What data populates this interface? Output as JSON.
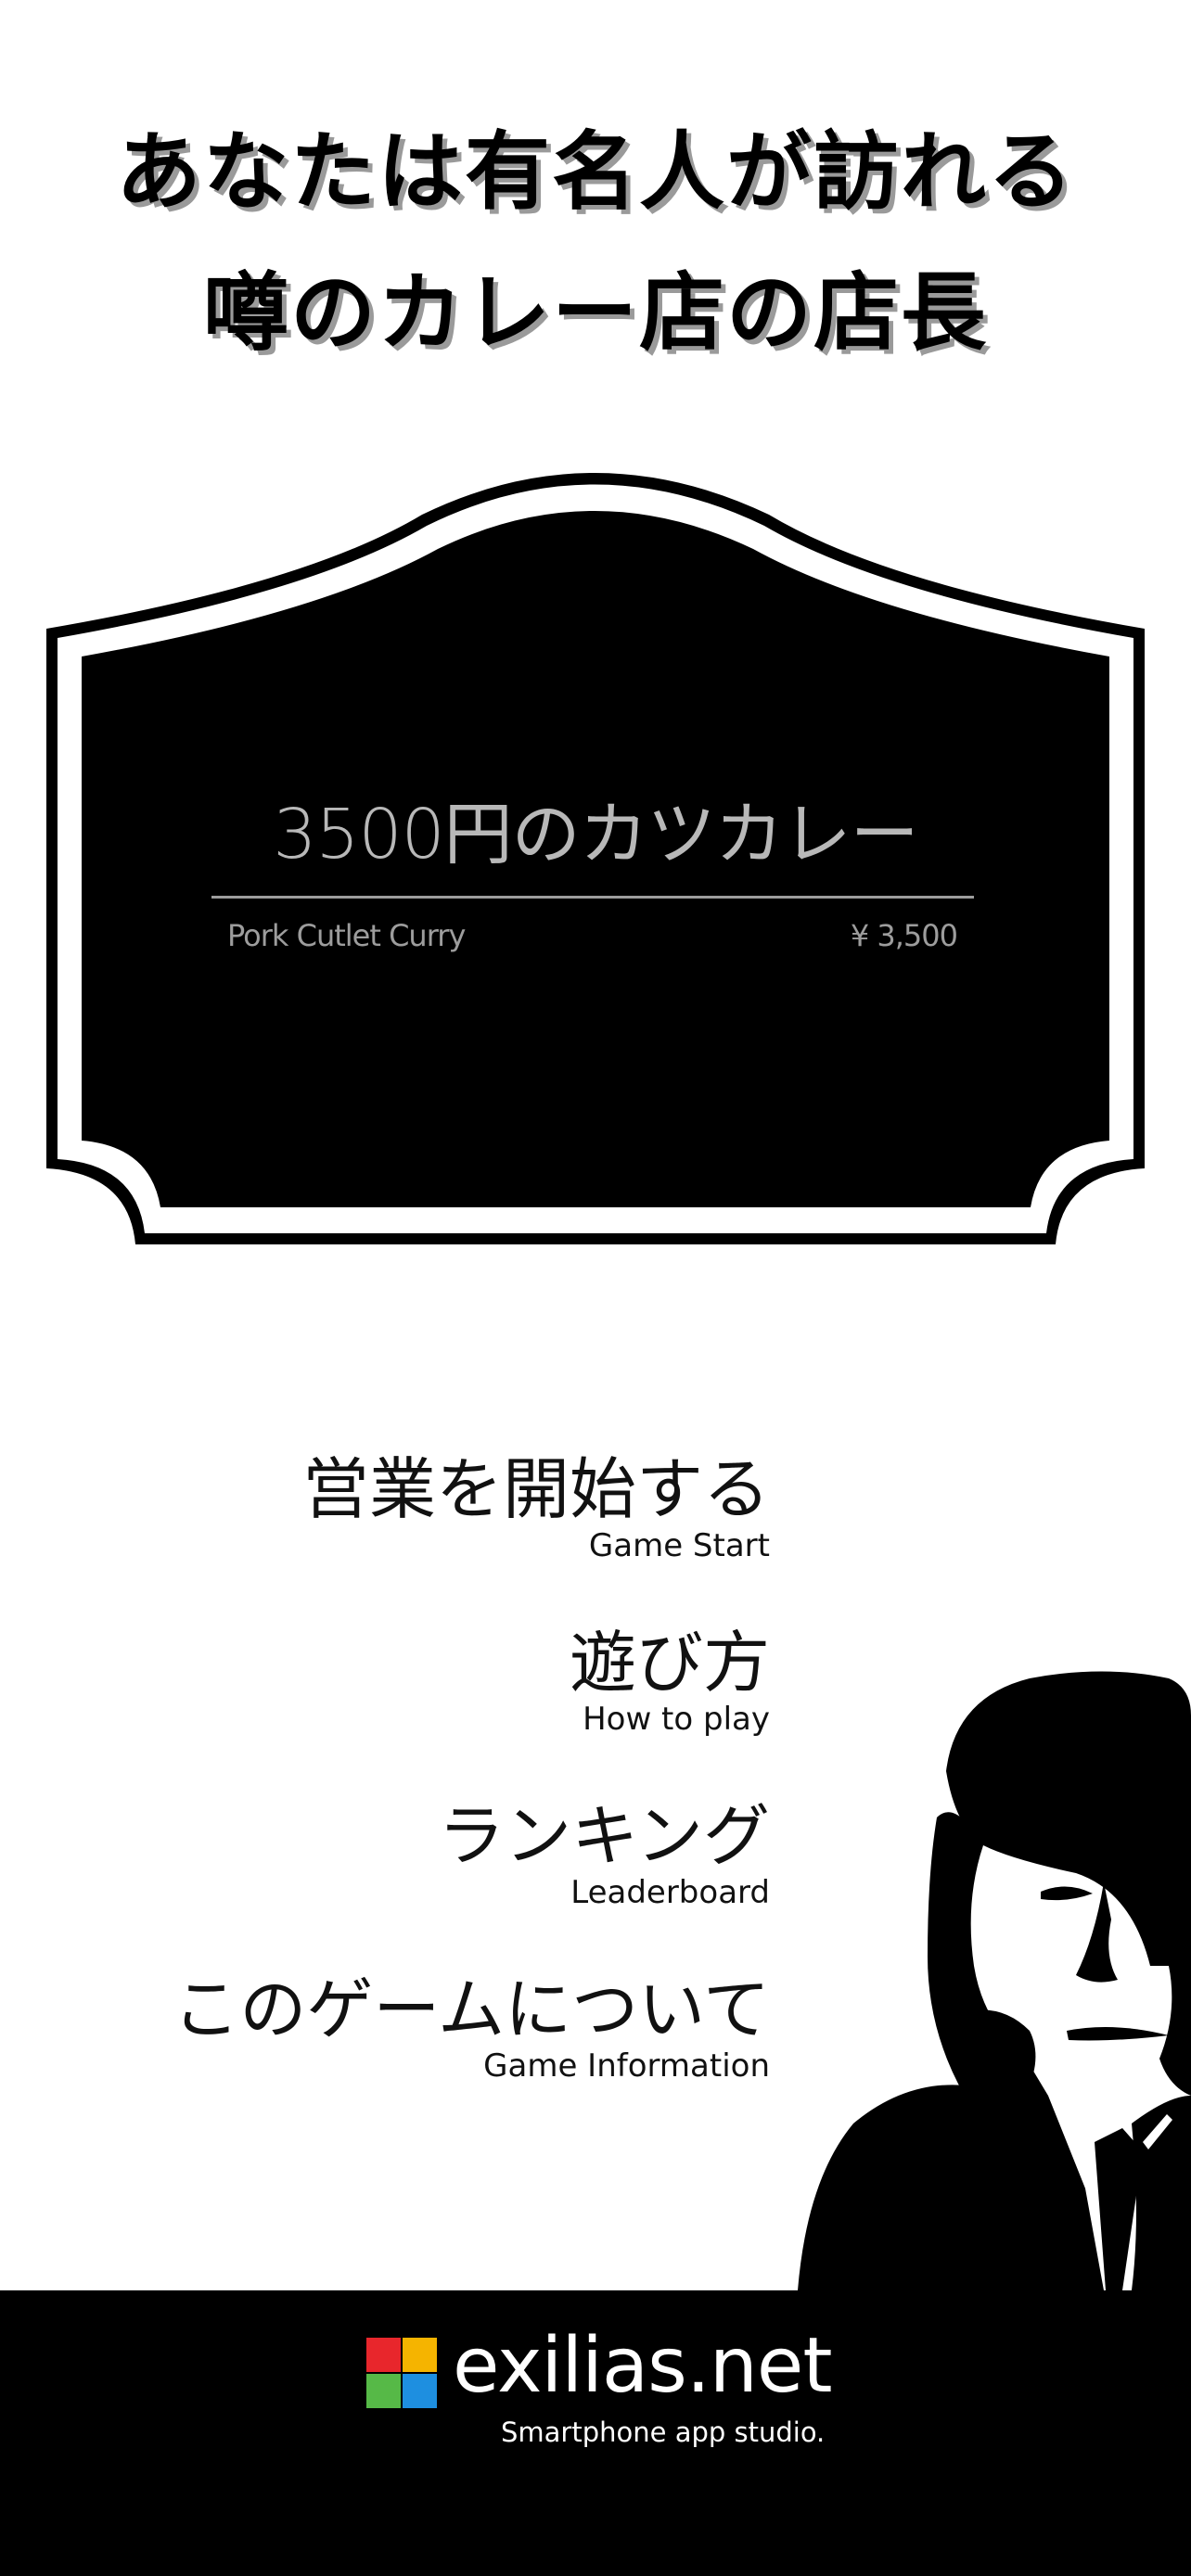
{
  "headline": {
    "line1": "あなたは有名人が訪れる",
    "line2": "噂のカレー店の店長"
  },
  "sign": {
    "title": "3500円のカツカレー",
    "subtitle_en": "Pork Cutlet Curry",
    "price": "¥ 3,500"
  },
  "menu": {
    "items": [
      {
        "label_jp": "営業を開始する",
        "label_en": "Game Start"
      },
      {
        "label_jp": "遊び方",
        "label_en": "How to play"
      },
      {
        "label_jp": "ランキング",
        "label_en": "Leaderboard"
      },
      {
        "label_jp": "このゲームについて",
        "label_en": "Game Information"
      }
    ]
  },
  "footer": {
    "brand": "exilias.net",
    "tagline": "Smartphone app studio.",
    "logo_colors": [
      "#e8262c",
      "#f5b400",
      "#56b947",
      "#1e8fe0"
    ]
  },
  "colors": {
    "background": "#ffffff",
    "sign_fill": "#000000",
    "footer_bg": "#000000"
  }
}
